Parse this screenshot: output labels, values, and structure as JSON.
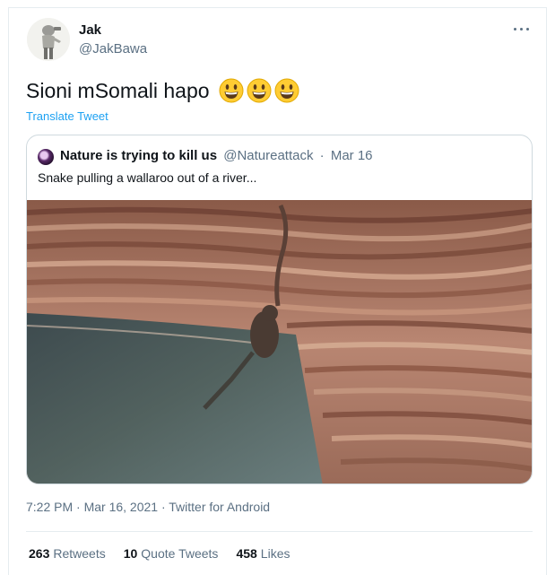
{
  "author": {
    "name": "Jak",
    "handle": "@JakBawa"
  },
  "tweet": {
    "text": "Sioni mSomali hapo",
    "emojis": [
      "grinning-face-emoji",
      "grinning-face-emoji",
      "grinning-face-emoji"
    ],
    "translate_label": "Translate Tweet"
  },
  "quoted_tweet": {
    "name": "Nature is trying to kill us",
    "handle": "@Natureattack",
    "separator": "·",
    "date": "Mar 16",
    "text": "Snake pulling a wallaroo out of a river..."
  },
  "meta": {
    "timestamp": "7:22 PM · Mar 16, 2021 · Twitter for Android"
  },
  "stats": {
    "retweets_count": "263",
    "retweets_label": "Retweets",
    "quotes_count": "10",
    "quotes_label": "Quote Tweets",
    "likes_count": "458",
    "likes_label": "Likes"
  },
  "colors": {
    "link": "#1da1f2",
    "secondary_text": "#5b7083",
    "border": "#cfd9de"
  }
}
